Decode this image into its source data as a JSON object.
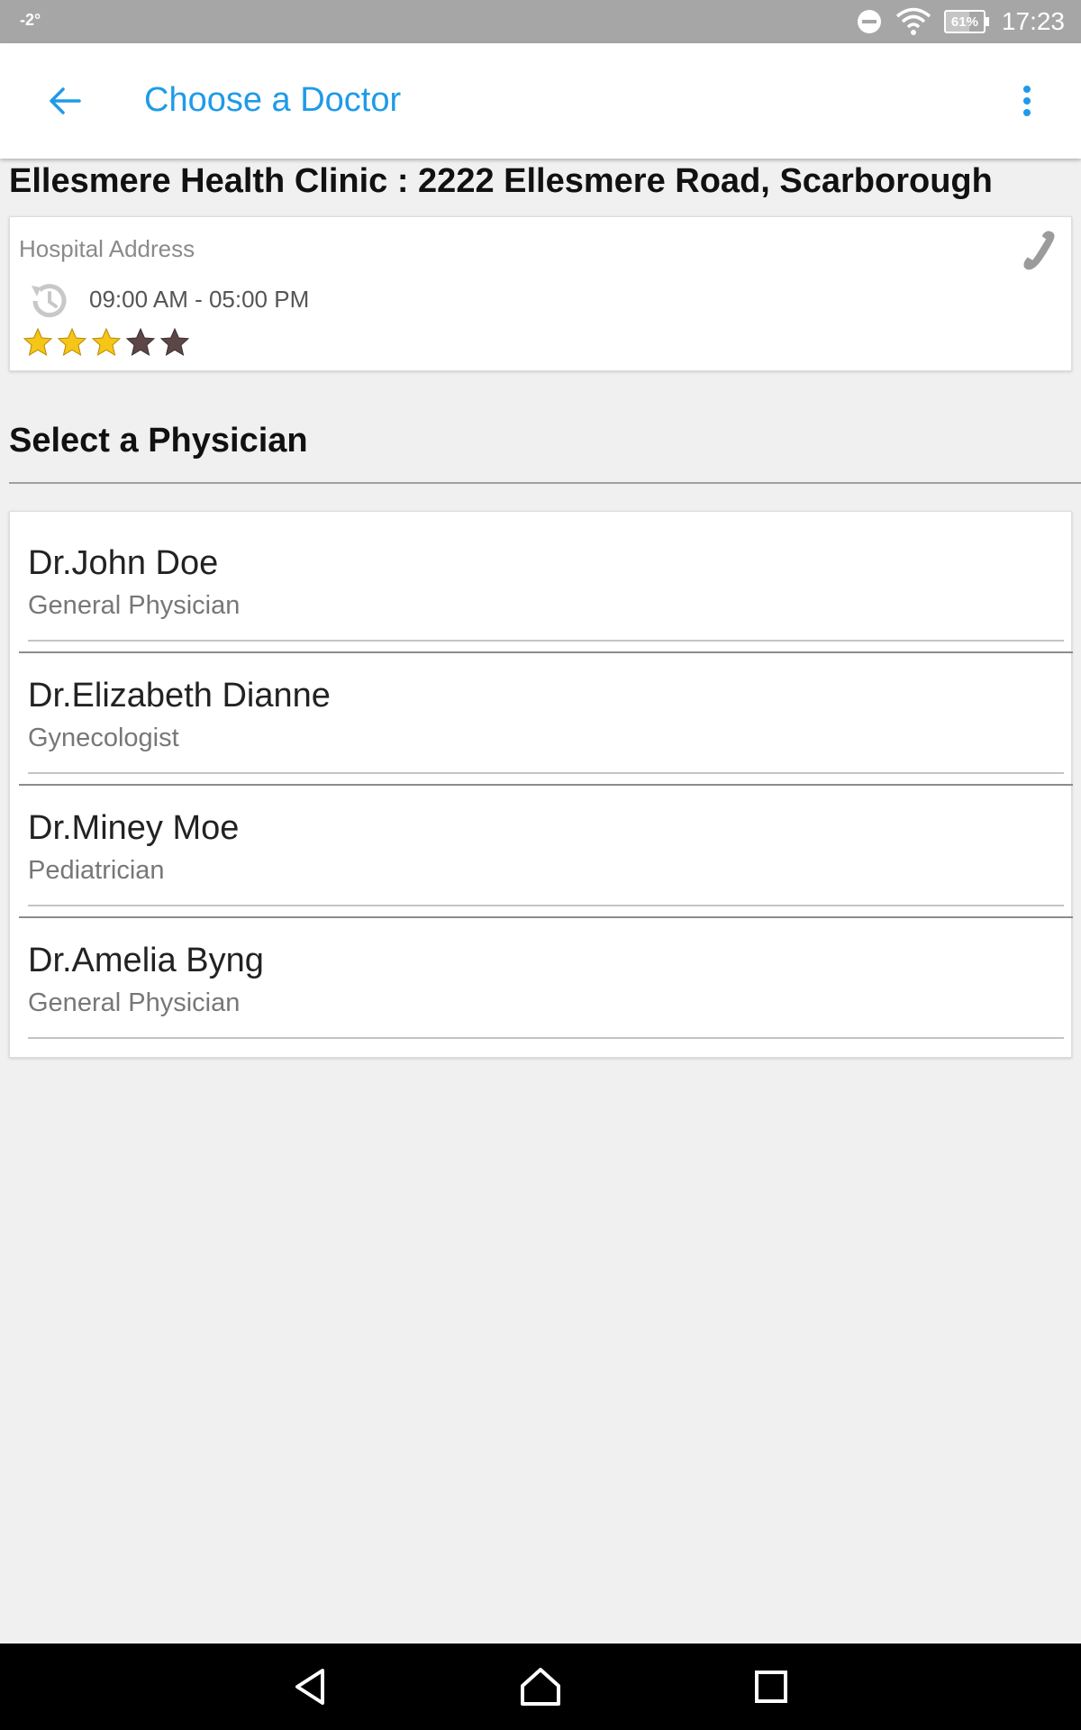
{
  "status_bar": {
    "left_text": "-2°",
    "battery_level": "61%",
    "battery_fraction": 0.61,
    "time": "17:23",
    "icons": [
      "do-not-disturb-icon",
      "wifi-icon",
      "battery-icon"
    ]
  },
  "app_bar": {
    "title": "Choose a Doctor",
    "back_icon": "arrow-back-icon",
    "menu_icon": "more-vert-icon"
  },
  "clinic": {
    "title": "Ellesmere Health Clinic : 2222 Ellesmere Road, Scarborough",
    "address_label": "Hospital Address",
    "hours": "09:00 AM - 05:00 PM",
    "rating": 3,
    "rating_max": 5
  },
  "section": {
    "title": "Select a Physician"
  },
  "physicians": [
    {
      "name": "Dr.John Doe",
      "specialty": "General Physician"
    },
    {
      "name": "Dr.Elizabeth Dianne",
      "specialty": "Gynecologist"
    },
    {
      "name": "Dr.Miney Moe",
      "specialty": "Pediatrician"
    },
    {
      "name": "Dr.Amelia Byng",
      "specialty": "General Physician"
    }
  ],
  "colors": {
    "accent": "#1e9be8",
    "star_filled": "#f5c518",
    "star_empty": "#5d4646"
  }
}
